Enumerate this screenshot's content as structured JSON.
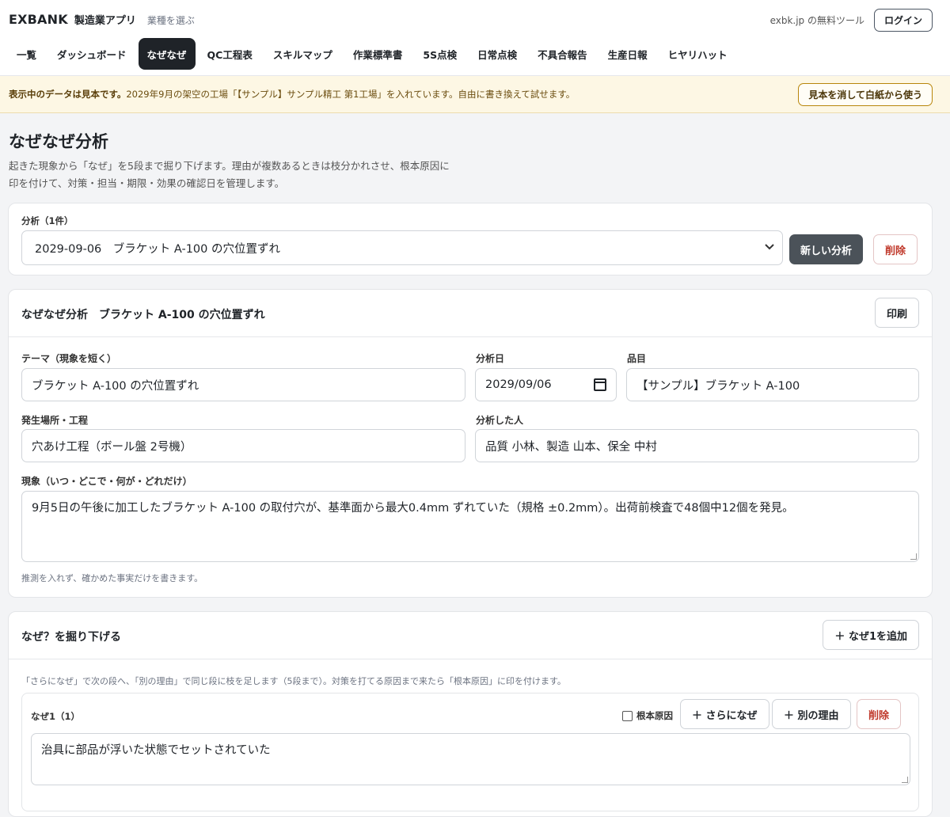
{
  "header": {
    "logo": "EXBANK",
    "app_name": "製造業アプリ",
    "industry_link": "業種を選ぶ",
    "free_tool": "exbk.jp の無料ツール",
    "login": "ログイン"
  },
  "nav": {
    "tabs": [
      {
        "label": "一覧"
      },
      {
        "label": "ダッシュボード"
      },
      {
        "label": "なぜなぜ"
      },
      {
        "label": "QC工程表"
      },
      {
        "label": "スキルマップ"
      },
      {
        "label": "作業標準書"
      },
      {
        "label": "5S点検"
      },
      {
        "label": "日常点検"
      },
      {
        "label": "不具合報告"
      },
      {
        "label": "生産日報"
      },
      {
        "label": "ヒヤリハット"
      }
    ]
  },
  "banner": {
    "bold_text": "表示中のデータは見本です。",
    "text": "2029年9月の架空の工場「【サンプル】サンプル精工 第1工場」を入れています。自由に書き換えて試せます。",
    "button": "見本を消して白紙から使う"
  },
  "page": {
    "title": "なぜなぜ分析",
    "description": "起きた現象から「なぜ」を5段まで掘り下げます。理由が複数あるときは枝分かれさせ、根本原因に印を付けて、対策・担当・期限・効果の確認日を管理します。"
  },
  "analysis_select": {
    "label": "分析（1件）",
    "selected": "2029-09-06　ブラケット A-100 の穴位置ずれ",
    "new_button": "新しい分析",
    "delete_button": "削除"
  },
  "detail": {
    "title": "なぜなぜ分析　ブラケット A-100 の穴位置ずれ",
    "print_button": "印刷",
    "theme_label": "テーマ（現象を短く）",
    "theme_value": "ブラケット A-100 の穴位置ずれ",
    "date_label": "分析日",
    "date_value": "2029/09/06",
    "item_label": "品目",
    "item_value": "【サンプル】ブラケット A-100",
    "place_label": "発生場所・工程",
    "place_value": "穴あけ工程（ボール盤 2号機）",
    "analyst_label": "分析した人",
    "analyst_value": "品質 小林、製造 山本、保全 中村",
    "phenomenon_label": "現象（いつ・どこで・何が・どれだけ）",
    "phenomenon_value": "9月5日の午後に加工したブラケット A-100 の取付穴が、基準面から最大0.4mm ずれていた（規格 ±0.2mm）。出荷前検査で48個中12個を発見。",
    "phenomenon_hint": "推測を入れず、確かめた事実だけを書きます。"
  },
  "why_section": {
    "title": "なぜ？を掘り下げる",
    "add_button": "＋ なぜ1を追加",
    "hint": "「さらになぜ」で次の段へ、「別の理由」で同じ段に枝を足します（5段まで）。対策を打てる原因まで来たら「根本原因」に印を付けます。",
    "why1": {
      "label": "なぜ1（1）",
      "root_cause_label": "根本原因",
      "deeper_button": "＋ さらになぜ",
      "other_button": "＋ 別の理由",
      "delete_button": "削除",
      "text": "治具に部品が浮いた状態でセットされていた"
    }
  }
}
